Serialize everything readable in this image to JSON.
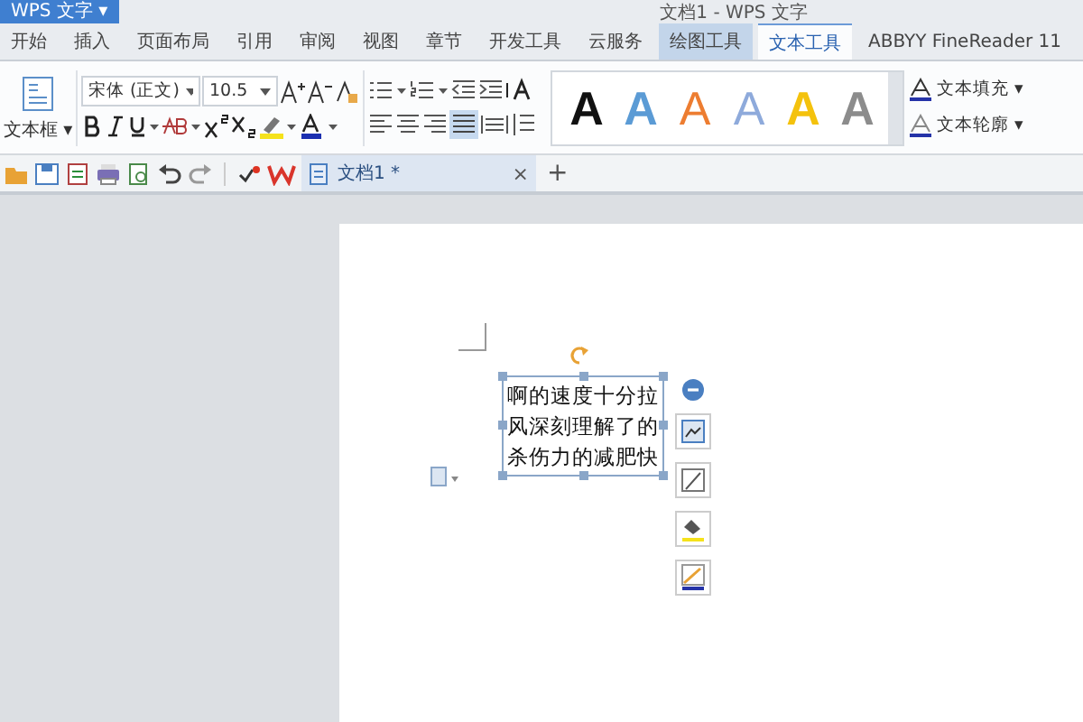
{
  "app_menu": {
    "label": "WPS 文字 ▾"
  },
  "window": {
    "title": "文档1 - WPS 文字"
  },
  "tabs": [
    {
      "label": "开始",
      "selected": false,
      "highlighted": false
    },
    {
      "label": "插入",
      "selected": false,
      "highlighted": false
    },
    {
      "label": "页面布局",
      "selected": false,
      "highlighted": false
    },
    {
      "label": "引用",
      "selected": false,
      "highlighted": false
    },
    {
      "label": "审阅",
      "selected": false,
      "highlighted": false
    },
    {
      "label": "视图",
      "selected": false,
      "highlighted": false
    },
    {
      "label": "章节",
      "selected": false,
      "highlighted": false
    },
    {
      "label": "开发工具",
      "selected": false,
      "highlighted": false
    },
    {
      "label": "云服务",
      "selected": false,
      "highlighted": false
    },
    {
      "label": "绘图工具",
      "selected": false,
      "highlighted": true
    },
    {
      "label": "文本工具",
      "selected": true,
      "highlighted": false
    },
    {
      "label": "ABBYY FineReader 11",
      "selected": false,
      "highlighted": false
    }
  ],
  "ribbon": {
    "textbox_button": "文本框 ▾",
    "font_name": "宋体 (正文)",
    "font_size": "10.5",
    "wordart_styles": [
      {
        "label": "A",
        "kind": "fill",
        "color": "#111111"
      },
      {
        "label": "A",
        "kind": "fill",
        "color": "#5b9bd5"
      },
      {
        "label": "A",
        "kind": "outline",
        "color": "#ed7d31"
      },
      {
        "label": "A",
        "kind": "outline",
        "color": "#8eaadb"
      },
      {
        "label": "A",
        "kind": "fill",
        "color": "#f4c20d"
      },
      {
        "label": "A",
        "kind": "fill",
        "color": "#8c8c8c"
      }
    ],
    "text_fill": "文本填充 ▾",
    "text_outline": "文本轮廓 ▾"
  },
  "document_tab": {
    "title": "文档1 *",
    "close": "×",
    "new_tab": "+"
  },
  "text_box": {
    "text": "啊的速度十分拉风深刻理解了的杀伤力的减肥快"
  }
}
